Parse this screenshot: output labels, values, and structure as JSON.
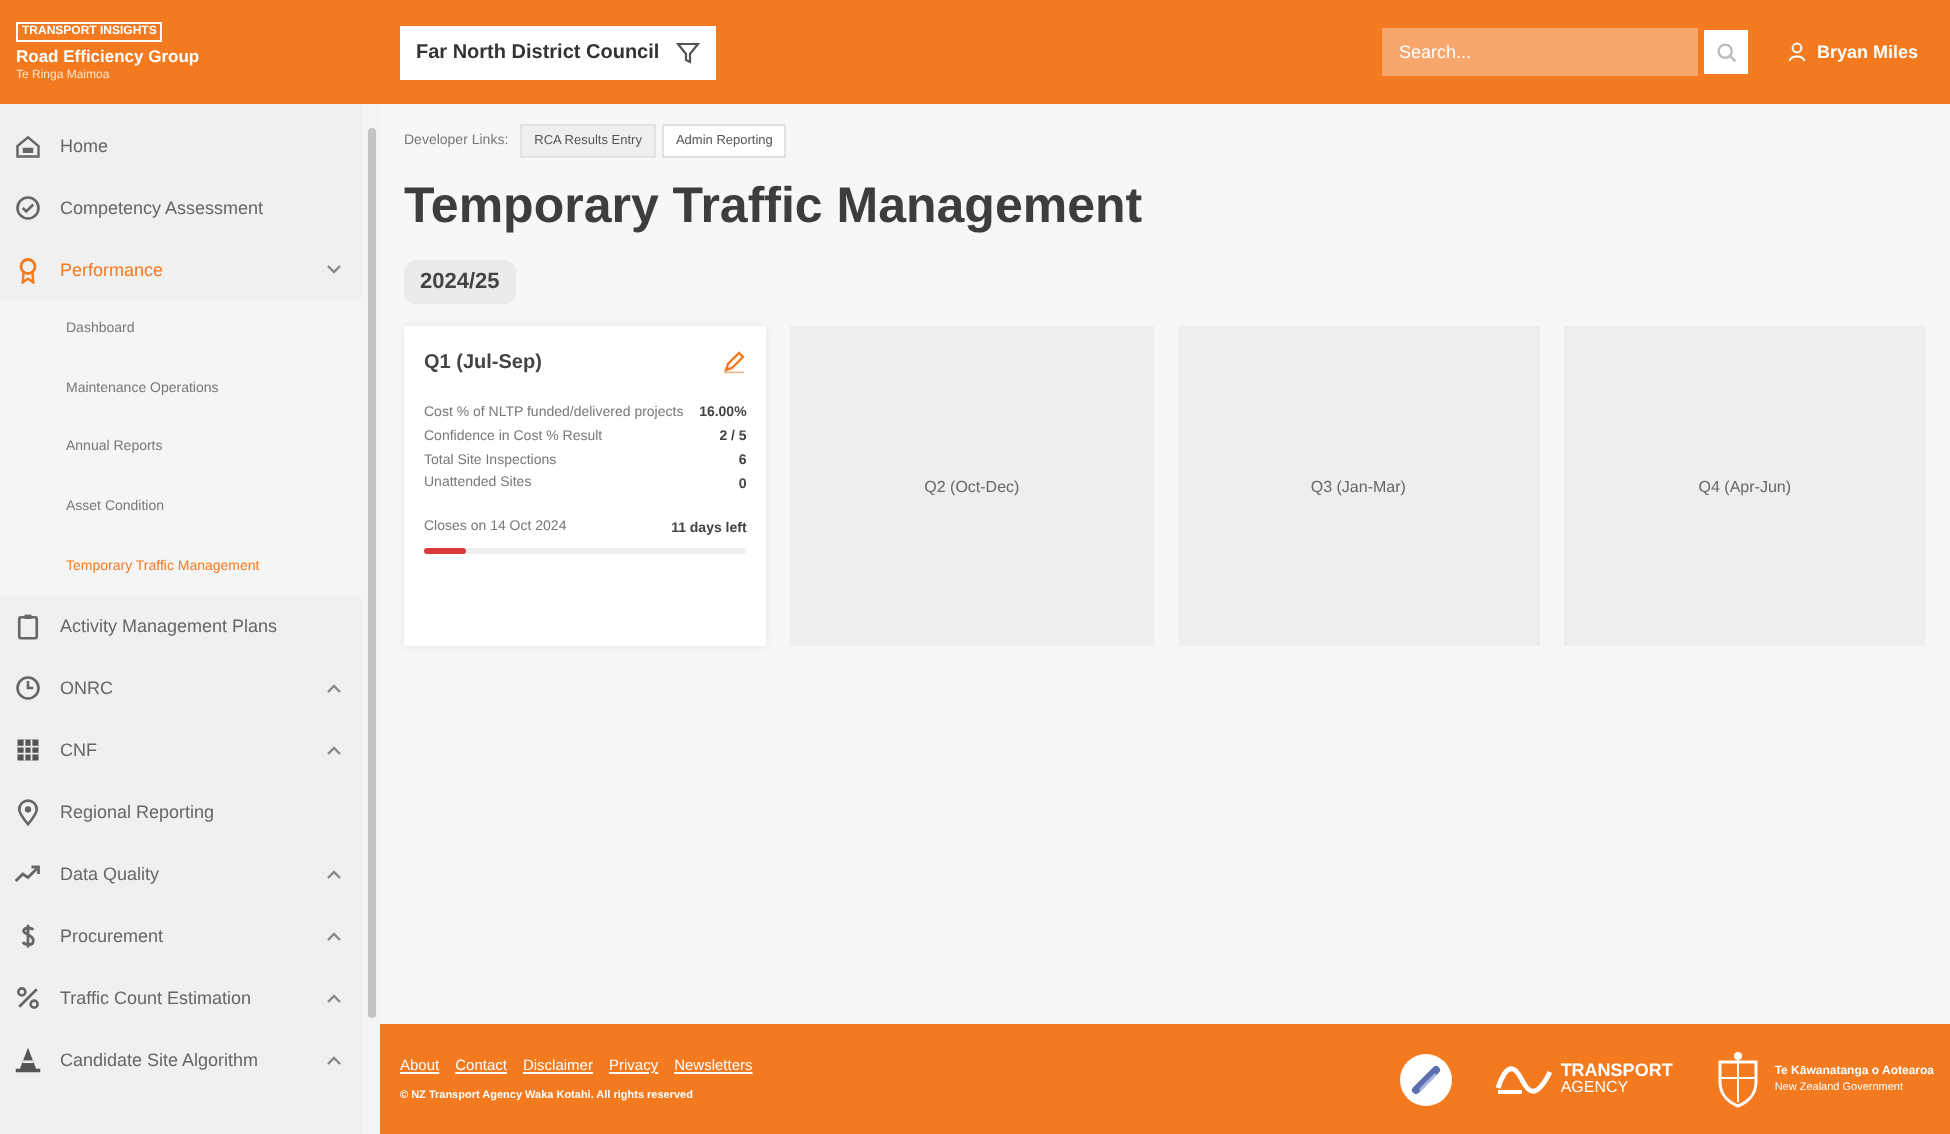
{
  "header": {
    "brand_tag": "TRANSPORT INSIGHTS",
    "brand_name": "Road Efficiency Group",
    "brand_sub": "Te Ringa Maimoa",
    "council": "Far North District Council",
    "search": {
      "placeholder": "Search..."
    },
    "user": "Bryan Miles"
  },
  "sidebar": {
    "items": [
      {
        "label": "Home",
        "kind": "link",
        "selected": false
      },
      {
        "label": "Competency Assessment",
        "kind": "link",
        "selected": false
      },
      {
        "label": "Performance",
        "kind": "group",
        "expanded": true,
        "selected": true,
        "children": [
          {
            "label": "Dashboard",
            "selected": false
          },
          {
            "label": "Maintenance Operations",
            "selected": false
          },
          {
            "label": "Annual Reports",
            "selected": false
          },
          {
            "label": "Asset Condition",
            "selected": false
          },
          {
            "label": "Temporary Traffic Management",
            "selected": true
          }
        ]
      },
      {
        "label": "Activity Management Plans",
        "kind": "link",
        "selected": false
      },
      {
        "label": "ONRC",
        "kind": "group",
        "expanded": false,
        "selected": false
      },
      {
        "label": "CNF",
        "kind": "group",
        "expanded": false,
        "selected": false
      },
      {
        "label": "Regional Reporting",
        "kind": "link",
        "selected": false
      },
      {
        "label": "Data Quality",
        "kind": "group",
        "expanded": false,
        "selected": false
      },
      {
        "label": "Procurement",
        "kind": "group",
        "expanded": false,
        "selected": false
      },
      {
        "label": "Traffic Count Estimation",
        "kind": "group",
        "expanded": false,
        "selected": false
      },
      {
        "label": "Candidate Site Algorithm",
        "kind": "group",
        "expanded": false,
        "selected": false
      }
    ]
  },
  "dev_links": {
    "label": "Developer Links:",
    "links": [
      "RCA Results Entry",
      "Admin Reporting"
    ]
  },
  "title": "Temporary Traffic Management",
  "year": "2024/25",
  "quarters": [
    {
      "title": "Q1 (Jul-Sep)",
      "kind": "open",
      "metrics": [
        {
          "label": "Cost % of NLTP funded/delivered projects",
          "value": "16.00%"
        },
        {
          "label": "Confidence in Cost % Result",
          "value": "2 / 5"
        },
        {
          "label": "Total Site Inspections",
          "value": "6"
        },
        {
          "label": "Unattended Sites",
          "value": "0"
        }
      ],
      "closes": "Closes on 14 Oct 2024",
      "remaining": "11 days left",
      "level": 0.13
    },
    {
      "title": "Q2 (Oct-Dec)",
      "kind": "future"
    },
    {
      "title": "Q3 (Jan-Mar)",
      "kind": "future"
    },
    {
      "title": "Q4 (Apr-Jun)",
      "kind": "future"
    }
  ],
  "footer": {
    "links": [
      "About",
      "Contact",
      "Disclaimer",
      "Privacy",
      "Newsletters"
    ],
    "copyright": "© NZ Transport Agency Waka Kotahi. All rights reserved",
    "agency": "TRANSPORT",
    "agency_sub": "AGENCY",
    "gov": "Te Kāwanatanga o Aotearoa",
    "gov_sub": "New Zealand Government"
  }
}
